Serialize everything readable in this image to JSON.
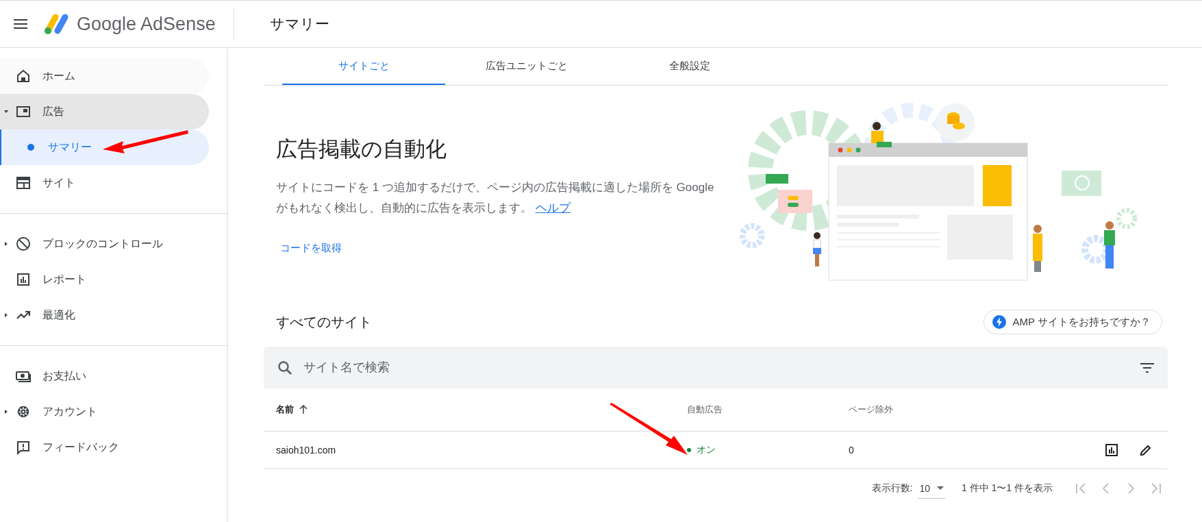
{
  "header": {
    "product": "Google AdSense",
    "page_title": "サマリー"
  },
  "sidebar": {
    "sections": [
      {
        "items": [
          {
            "label": "ホーム",
            "kind": "link",
            "selected": false
          },
          {
            "label": "広告",
            "kind": "group",
            "expanded": true,
            "selected": false,
            "children": [
              {
                "label": "サマリー",
                "selected": true
              }
            ]
          },
          {
            "label": "サイト",
            "kind": "link",
            "selected": false
          }
        ]
      },
      {
        "items": [
          {
            "label": "ブロックのコントロール",
            "kind": "group",
            "expanded": false,
            "selected": false
          },
          {
            "label": "レポート",
            "kind": "link",
            "selected": false
          },
          {
            "label": "最適化",
            "kind": "group",
            "expanded": false,
            "selected": false
          }
        ]
      },
      {
        "items": [
          {
            "label": "お支払い",
            "kind": "link",
            "selected": false
          },
          {
            "label": "アカウント",
            "kind": "group",
            "expanded": false,
            "selected": false
          },
          {
            "label": "フィードバック",
            "kind": "link",
            "selected": false
          }
        ]
      }
    ]
  },
  "tabs": [
    {
      "label": "サイトごと",
      "selected": true
    },
    {
      "label": "広告ユニットごと",
      "selected": false
    },
    {
      "label": "全般設定",
      "selected": false
    }
  ],
  "hero": {
    "title": "広告掲載の自動化",
    "description": "サイトにコードを 1 つ追加するだけで、ページ内の広告掲載に適した場所を Google がもれなく検出し、自動的に広告を表示します。",
    "help_link": "ヘルプ",
    "action": "コードを取得"
  },
  "sites": {
    "title": "すべてのサイト",
    "amp_button": "AMP サイトをお持ちですか？",
    "search": {
      "placeholder": "サイト名で検索"
    },
    "columns": [
      {
        "label": "名前",
        "sorted": true
      },
      {
        "label": "自動広告",
        "sorted": false
      },
      {
        "label": "ページ除外",
        "sorted": false
      }
    ],
    "rows": [
      {
        "name": "saioh101.com",
        "auto_ads": {
          "label": "オン",
          "on": true
        },
        "page_exclusion": "0"
      }
    ],
    "pagination": {
      "rows_label": "表示行数:",
      "rows_per_page": "10",
      "range": "1 件中 1〜1 件を表示",
      "first_disabled": true,
      "prev_disabled": true,
      "next_disabled": true,
      "last_disabled": true
    }
  }
}
